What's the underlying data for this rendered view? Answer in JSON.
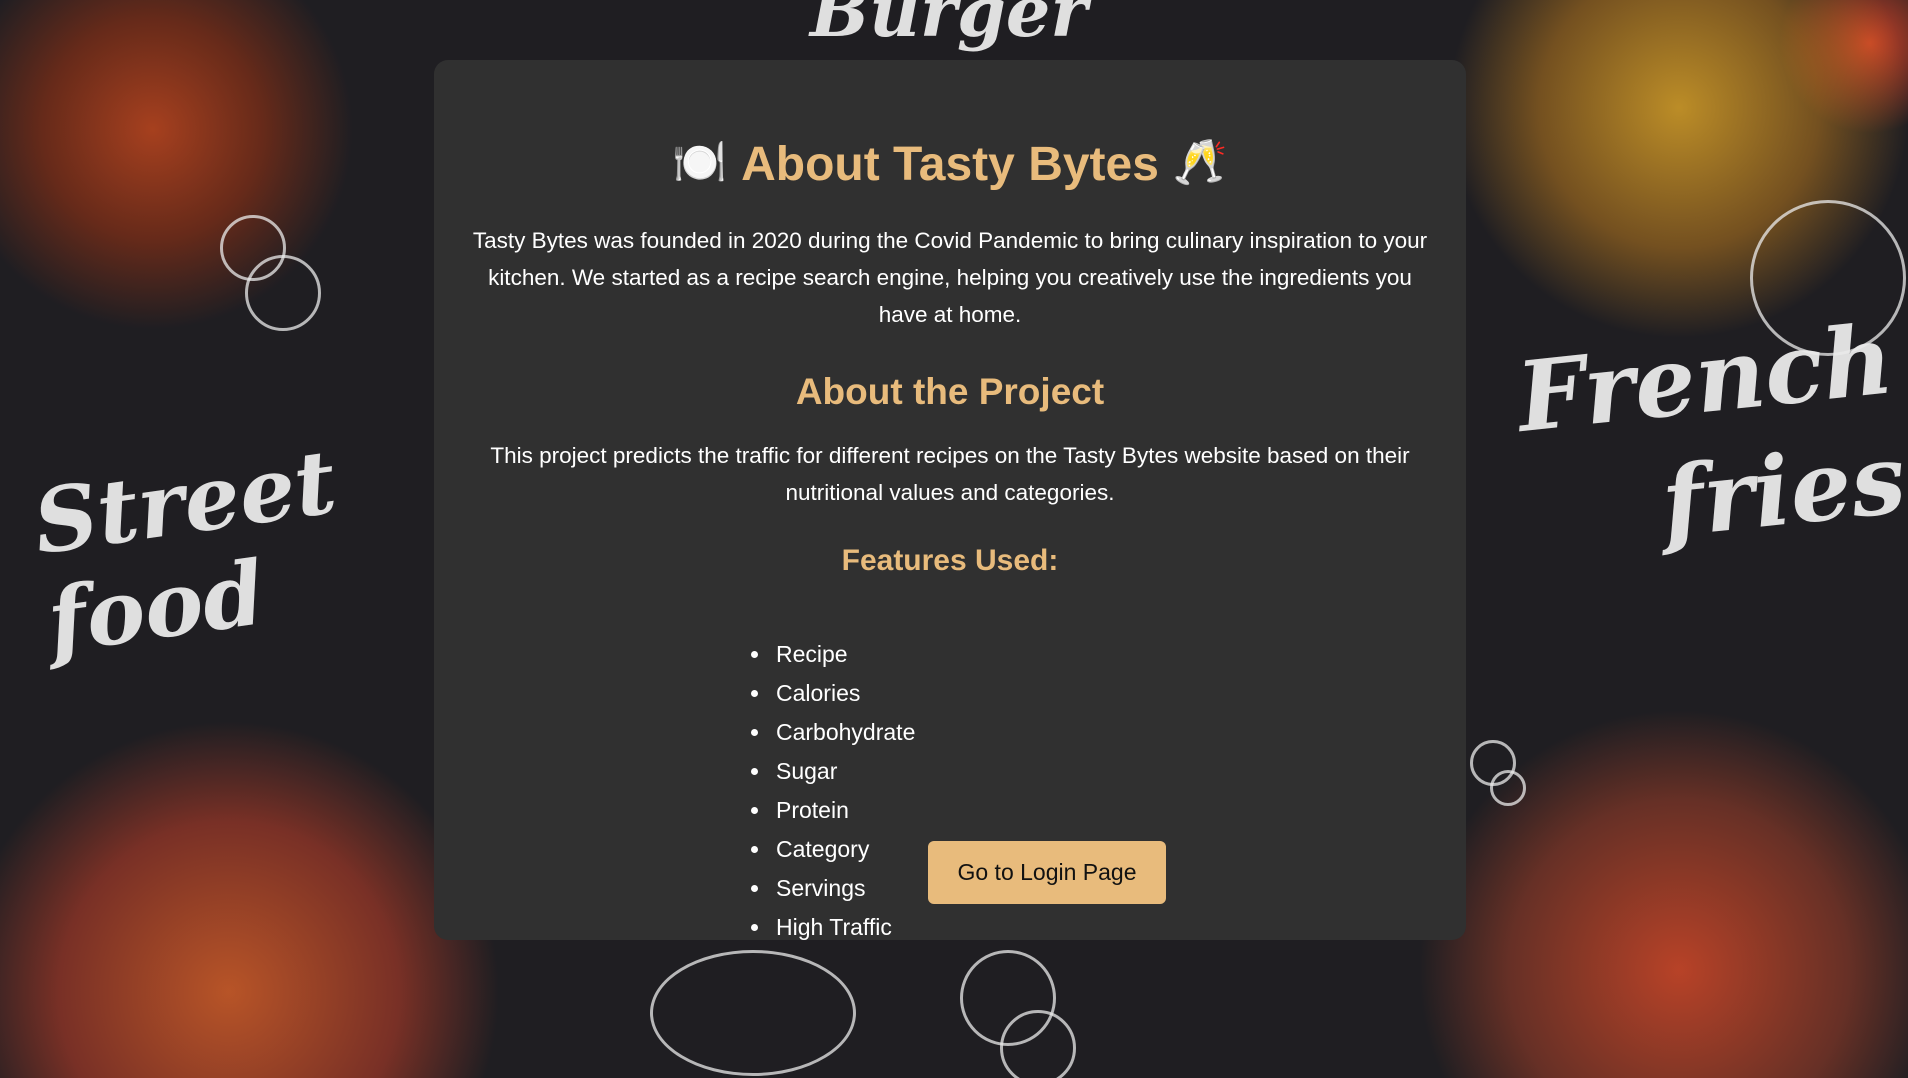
{
  "header": {
    "title": "About Tasty Bytes",
    "title_emoji_left": "🍽️",
    "title_emoji_right": "🥂"
  },
  "intro": {
    "text": "Tasty Bytes was founded in 2020 during the Covid Pandemic to bring culinary inspiration to your kitchen. We started as a recipe search engine, helping you creatively use the ingredients you have at home."
  },
  "project": {
    "heading": "About the Project",
    "text": "This project predicts the traffic for different recipes on the Tasty Bytes website based on their nutritional values and categories."
  },
  "features": {
    "heading": "Features Used:",
    "items": [
      "Recipe",
      "Calories",
      "Carbohydrate",
      "Sugar",
      "Protein",
      "Category",
      "Servings",
      "High Traffic"
    ]
  },
  "actions": {
    "login_label": "Go to Login Page"
  },
  "background": {
    "text_left": "Street food",
    "text_right": "French fries",
    "text_top": "Burger"
  },
  "colors": {
    "accent": "#e8bb7c",
    "card": "#303030",
    "background": "#1f1e22"
  }
}
